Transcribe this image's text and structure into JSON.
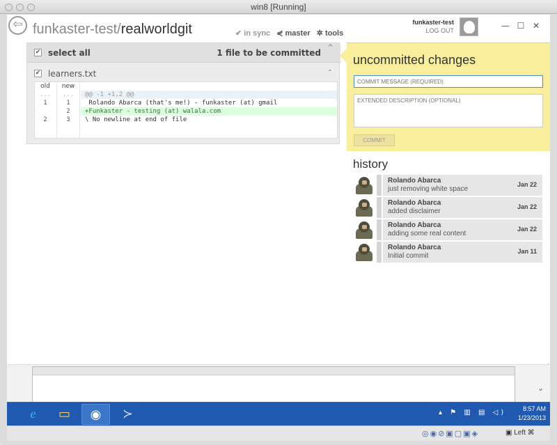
{
  "window": {
    "title": "win8 [Running]"
  },
  "header": {
    "back_glyph": "⇦",
    "repo_owner": "funkaster-test/",
    "repo_name": "realworldgit",
    "sync_label": "✔ in sync",
    "branch_label": "⋞ master",
    "tools_label": "✲ tools",
    "username": "funkaster-test",
    "logout_label": "LOG OUT",
    "min_glyph": "—",
    "max_glyph": "☐",
    "close_glyph": "✕"
  },
  "changes": {
    "select_all_label": "select all",
    "commit_count": "1 file to be committed",
    "collapse_glyph": "⌃",
    "file_collapse_glyph": "⌃",
    "check_glyph": "✔",
    "file": {
      "name": "learners.txt",
      "header": {
        "old": "old",
        "new": "new"
      },
      "lines": [
        {
          "old": "...",
          "new": "...",
          "code": "@@ -1 +1,2 @@",
          "kind": "hunk"
        },
        {
          "old": "1",
          "new": "1",
          "code": " Rolando Abarca (that's me!) - funkaster (at) gmail",
          "kind": "ctx"
        },
        {
          "old": "",
          "new": "2",
          "code": "+Funkaster - testing (at) walala.com",
          "kind": "add"
        },
        {
          "old": "2",
          "new": "3",
          "code": "\\ No newline at end of file",
          "kind": "ctx"
        }
      ]
    }
  },
  "uncommitted": {
    "title": "uncommitted changes",
    "commit_msg_placeholder": "COMMIT MESSAGE (REQUIRED)",
    "ext_desc_placeholder": "EXTENDED DESCRIPTION (OPTIONAL)",
    "commit_button": "COMMIT"
  },
  "history": {
    "title": "history",
    "items": [
      {
        "author": "Rolando Abarca",
        "message": "just removing white space",
        "date": "Jan 22"
      },
      {
        "author": "Rolando Abarca",
        "message": "added disclaimer",
        "date": "Jan 22"
      },
      {
        "author": "Rolando Abarca",
        "message": "adding some real content",
        "date": "Jan 22"
      },
      {
        "author": "Rolando Abarca",
        "message": "Initial commit",
        "date": "Jan 11"
      }
    ]
  },
  "taskbar": {
    "apps": [
      {
        "icon": "internet-explorer-icon",
        "glyph": "e"
      },
      {
        "icon": "file-explorer-icon",
        "glyph": "▭"
      },
      {
        "icon": "github-app-icon",
        "glyph": "◉"
      },
      {
        "icon": "powershell-icon",
        "glyph": "≻"
      }
    ],
    "tray_glyphs": "▴ ⚑ ▥ ▤ ◁)",
    "time": "8:57 AM",
    "date": "1/23/2013"
  },
  "vbox": {
    "icons": "◎◉⊘▣▢▣◈",
    "host_key": "▣ Left ⌘"
  },
  "scroll_down_glyph": "⌄",
  "resize_grip": "⋰"
}
